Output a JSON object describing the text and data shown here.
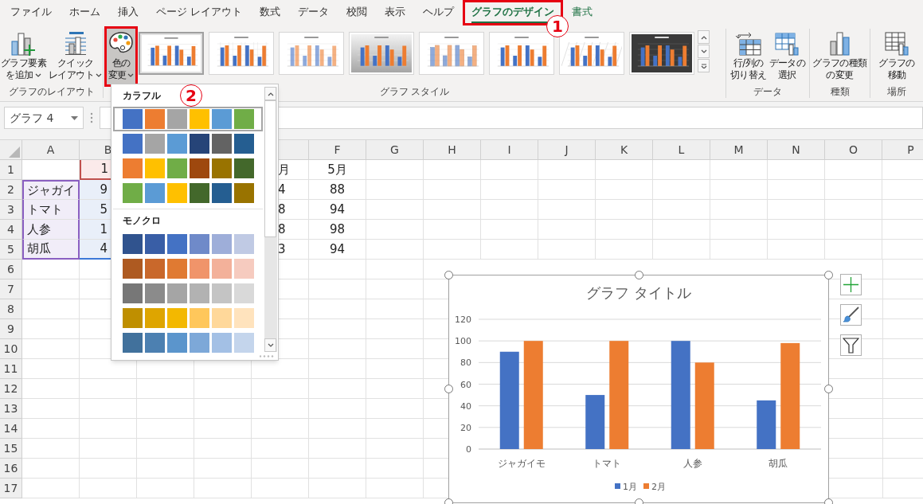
{
  "tabs": [
    {
      "label": "ファイル",
      "selected": false,
      "contextual": false,
      "highlighted": false
    },
    {
      "label": "ホーム",
      "selected": false,
      "contextual": false,
      "highlighted": false
    },
    {
      "label": "挿入",
      "selected": false,
      "contextual": false,
      "highlighted": false
    },
    {
      "label": "ページ レイアウト",
      "selected": false,
      "contextual": false,
      "highlighted": false
    },
    {
      "label": "数式",
      "selected": false,
      "contextual": false,
      "highlighted": false
    },
    {
      "label": "データ",
      "selected": false,
      "contextual": false,
      "highlighted": false
    },
    {
      "label": "校閲",
      "selected": false,
      "contextual": false,
      "highlighted": false
    },
    {
      "label": "表示",
      "selected": false,
      "contextual": false,
      "highlighted": false
    },
    {
      "label": "ヘルプ",
      "selected": false,
      "contextual": false,
      "highlighted": false
    },
    {
      "label": "グラフのデザイン",
      "selected": true,
      "contextual": true,
      "highlighted": true
    },
    {
      "label": "書式",
      "selected": false,
      "contextual": true,
      "highlighted": false
    }
  ],
  "tab_callout": "1",
  "ribbon": {
    "groups": [
      {
        "label": "グラフのレイアウト",
        "buttons": [
          {
            "kind": "add_element",
            "lines": [
              "グラフ要素",
              "を追加"
            ],
            "dropdown": true,
            "pressed": false,
            "highlighted": false
          },
          {
            "kind": "quick_layout",
            "lines": [
              "クイック",
              "レイアウト"
            ],
            "dropdown": true,
            "pressed": false,
            "highlighted": false
          }
        ]
      },
      {
        "label": "グラフ スタイル",
        "buttons": [
          {
            "kind": "change_colors",
            "lines": [
              "色の",
              "変更"
            ],
            "dropdown": true,
            "pressed": true,
            "highlighted": true
          }
        ],
        "gallery": [
          {
            "kind": "plain",
            "selected": true
          },
          {
            "kind": "labels",
            "selected": false
          },
          {
            "kind": "striped",
            "selected": false
          },
          {
            "kind": "gradient",
            "selected": false
          },
          {
            "kind": "outlined",
            "selected": false
          },
          {
            "kind": "plain",
            "selected": false
          },
          {
            "kind": "hatched",
            "selected": false
          },
          {
            "kind": "dark",
            "selected": false
          }
        ]
      },
      {
        "label": "データ",
        "buttons": [
          {
            "kind": "switch_row_col",
            "lines": [
              "行/列の",
              "切り替え"
            ],
            "dropdown": false,
            "pressed": false,
            "highlighted": false
          },
          {
            "kind": "select_data",
            "lines": [
              "データの",
              "選択"
            ],
            "dropdown": false,
            "pressed": false,
            "highlighted": false
          }
        ]
      },
      {
        "label": "種類",
        "buttons": [
          {
            "kind": "change_type",
            "lines": [
              "グラフの種類",
              "の変更"
            ],
            "dropdown": false,
            "pressed": false,
            "highlighted": false
          }
        ]
      },
      {
        "label": "場所",
        "buttons": [
          {
            "kind": "move_chart",
            "lines": [
              "グラフの",
              "移動"
            ],
            "dropdown": false,
            "pressed": false,
            "highlighted": false
          }
        ]
      }
    ]
  },
  "name_box": {
    "value": "グラフ 4"
  },
  "sheet": {
    "columns_left": [
      "A",
      "B"
    ],
    "columns_right": [
      "F",
      "G",
      "H",
      "I",
      "J",
      "K",
      "L",
      "M",
      "N",
      "O",
      "P"
    ],
    "rows": [
      {
        "label": "1",
        "cells": [
          null,
          {
            "text": "1",
            "kind": "series_name"
          },
          null,
          null,
          {
            "text": "月"
          },
          {
            "text": "5月"
          }
        ]
      },
      {
        "label": "2",
        "cells": [
          {
            "text": "ジャガイ",
            "kind": "category"
          },
          {
            "text": "9",
            "kind": "values"
          },
          null,
          null,
          {
            "text": "4"
          },
          {
            "text": "88"
          }
        ]
      },
      {
        "label": "3",
        "cells": [
          {
            "text": "トマト",
            "kind": "category"
          },
          {
            "text": "5",
            "kind": "values"
          },
          null,
          null,
          {
            "text": "8"
          },
          {
            "text": "94"
          }
        ]
      },
      {
        "label": "4",
        "cells": [
          {
            "text": "人参",
            "kind": "category"
          },
          {
            "text": "1",
            "kind": "values"
          },
          null,
          null,
          {
            "text": "8"
          },
          {
            "text": "98"
          }
        ]
      },
      {
        "label": "5",
        "cells": [
          {
            "text": "胡瓜",
            "kind": "category"
          },
          {
            "text": "4",
            "kind": "values"
          },
          null,
          null,
          {
            "text": "3"
          },
          {
            "text": "94"
          }
        ]
      },
      {
        "label": "6"
      },
      {
        "label": "7"
      },
      {
        "label": "8"
      },
      {
        "label": "9"
      },
      {
        "label": "10"
      },
      {
        "label": "11"
      },
      {
        "label": "12"
      },
      {
        "label": "13"
      },
      {
        "label": "14"
      },
      {
        "label": "15"
      },
      {
        "label": "16"
      },
      {
        "label": "17"
      }
    ]
  },
  "color_menu": {
    "callout": "2",
    "sections": [
      {
        "title": "カラフル",
        "palettes": [
          {
            "selected": true,
            "swatches": [
              {
                "color": "#4472c4"
              },
              {
                "color": "#ed7d31"
              },
              {
                "color": "#a5a5a5"
              },
              {
                "color": "#ffc000"
              },
              {
                "color": "#5b9bd5"
              },
              {
                "color": "#70ad47"
              }
            ]
          },
          {
            "selected": false,
            "swatches": [
              {
                "color": "#4472c4"
              },
              {
                "color": "#a5a5a5"
              },
              {
                "color": "#5b9bd5"
              },
              {
                "color": "#264478"
              },
              {
                "color": "#636363"
              },
              {
                "color": "#255e91"
              }
            ]
          },
          {
            "selected": false,
            "swatches": [
              {
                "color": "#ed7d31"
              },
              {
                "color": "#ffc000"
              },
              {
                "color": "#70ad47"
              },
              {
                "color": "#9e480e"
              },
              {
                "color": "#997300"
              },
              {
                "color": "#43682b"
              }
            ]
          },
          {
            "selected": false,
            "swatches": [
              {
                "color": "#70ad47"
              },
              {
                "color": "#5b9bd5"
              },
              {
                "color": "#ffc000"
              },
              {
                "color": "#43682b"
              },
              {
                "color": "#255e91"
              },
              {
                "color": "#997300"
              }
            ]
          }
        ]
      },
      {
        "title": "モノクロ",
        "palettes": [
          {
            "selected": false,
            "swatches": [
              {
                "color": "#30538e"
              },
              {
                "color": "#395ea6"
              },
              {
                "color": "#4472c4"
              },
              {
                "color": "#6f8ac9"
              },
              {
                "color": "#9eaed9"
              },
              {
                "color": "#c0cae4"
              }
            ]
          },
          {
            "selected": false,
            "swatches": [
              {
                "color": "#ae5a21"
              },
              {
                "color": "#c9682b"
              },
              {
                "color": "#e07a32"
              },
              {
                "color": "#f0946a"
              },
              {
                "color": "#f3b19a"
              },
              {
                "color": "#f6cbbf"
              }
            ]
          },
          {
            "selected": false,
            "swatches": [
              {
                "color": "#777777"
              },
              {
                "color": "#8b8b8b"
              },
              {
                "color": "#a5a5a5"
              },
              {
                "color": "#b2b2b2"
              },
              {
                "color": "#c4c4c4"
              },
              {
                "color": "#d9d9d9"
              }
            ]
          },
          {
            "selected": false,
            "swatches": [
              {
                "color": "#bf8f00"
              },
              {
                "color": "#dea500"
              },
              {
                "color": "#f3b800"
              },
              {
                "color": "#ffc75b"
              },
              {
                "color": "#ffd89a"
              },
              {
                "color": "#ffe3bd"
              }
            ]
          },
          {
            "selected": false,
            "swatches": [
              {
                "color": "#41719c"
              },
              {
                "color": "#4c80b1"
              },
              {
                "color": "#5b95cc"
              },
              {
                "color": "#7da8d8"
              },
              {
                "color": "#a3c0e5"
              },
              {
                "color": "#c4d5ec"
              }
            ]
          }
        ]
      }
    ]
  },
  "chart": {
    "chart_data": {
      "type": "bar",
      "title": "グラフ タイトル",
      "categories": [
        "ジャガイモ",
        "トマト",
        "人参",
        "胡瓜"
      ],
      "series": [
        {
          "name": "1月",
          "color": "#4472c4",
          "values": [
            90,
            50,
            100,
            45
          ]
        },
        {
          "name": "2月",
          "color": "#ed7d31",
          "values": [
            100,
            100,
            80,
            98
          ]
        }
      ],
      "ylim": [
        0,
        120
      ],
      "yticks": [
        0,
        20,
        40,
        60,
        80,
        100,
        120
      ],
      "grid": true,
      "legend": "bottom"
    }
  }
}
